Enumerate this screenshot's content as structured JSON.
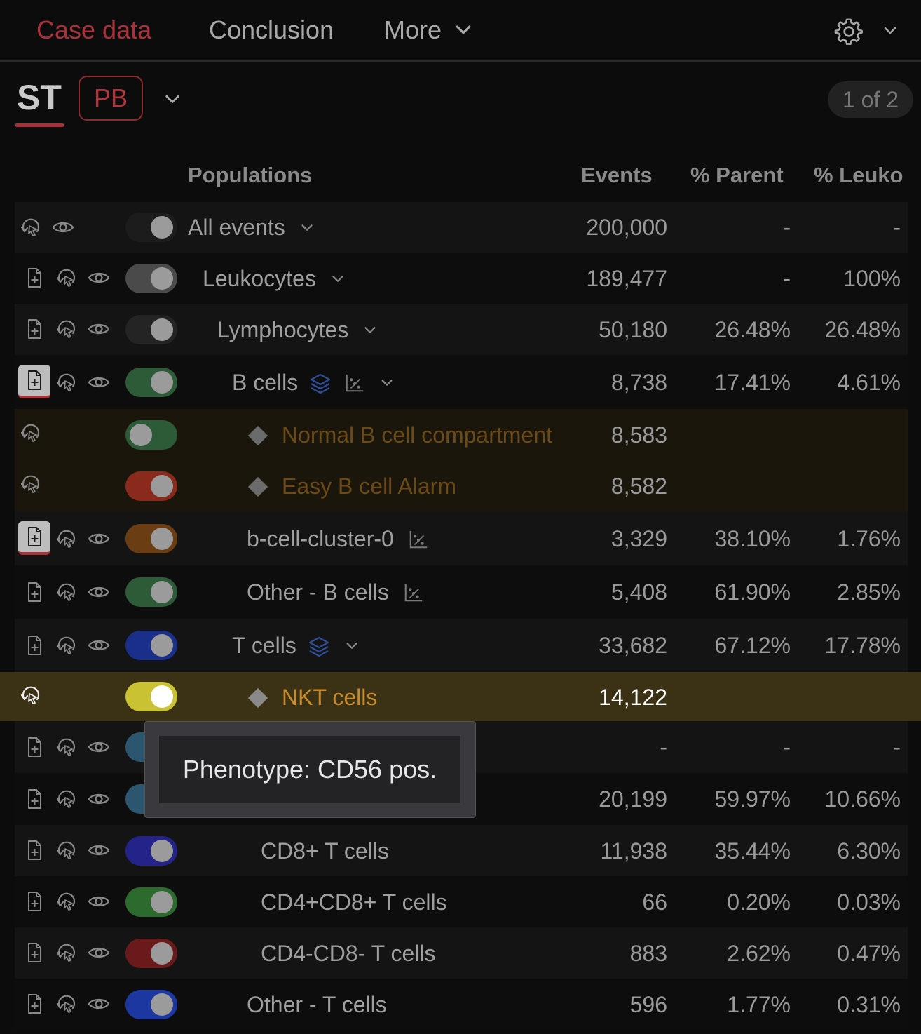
{
  "tabs": [
    {
      "label": "Case data",
      "active": true
    },
    {
      "label": "Conclusion",
      "active": false
    },
    {
      "label": "More",
      "active": false
    }
  ],
  "sample": {
    "code": "ST",
    "tube": "PB",
    "pager": "1 of 2"
  },
  "columns": {
    "populations": "Populations",
    "events": "Events",
    "parent": "% Parent",
    "leuko": "% Leuko"
  },
  "rows": [
    {
      "name": "All events",
      "events": "200,000",
      "parent": "-",
      "leuko": "-",
      "toggle_color": "#1c1c1c"
    },
    {
      "name": "Leukocytes",
      "events": "189,477",
      "parent": "-",
      "leuko": "100%",
      "toggle_color": "#4a4a4a"
    },
    {
      "name": "Lymphocytes",
      "events": "50,180",
      "parent": "26.48%",
      "leuko": "26.48%",
      "toggle_color": "#242424"
    },
    {
      "name": "B cells",
      "events": "8,738",
      "parent": "17.41%",
      "leuko": "4.61%",
      "toggle_color": "#2d5a37"
    },
    {
      "name": "Normal B cell compartment",
      "events": "8,583",
      "toggle_color": "#2d5a37"
    },
    {
      "name": "Easy B cell Alarm",
      "events": "8,582",
      "toggle_color": "#8a2a1c"
    },
    {
      "name": "b-cell-cluster-0",
      "events": "3,329",
      "parent": "38.10%",
      "leuko": "1.76%",
      "toggle_color": "#6a3d12"
    },
    {
      "name": "Other - B cells",
      "events": "5,408",
      "parent": "61.90%",
      "leuko": "2.85%",
      "toggle_color": "#2d5a37"
    },
    {
      "name": "T cells",
      "events": "33,682",
      "parent": "67.12%",
      "leuko": "17.78%",
      "toggle_color": "#1a2f8a"
    },
    {
      "name": "NKT cells",
      "events": "14,122",
      "toggle_color": "#c9c233"
    },
    {
      "events": "-",
      "parent": "-",
      "leuko": "-",
      "toggle_color": "#2c5670"
    },
    {
      "events": "20,199",
      "parent": "59.97%",
      "leuko": "10.66%",
      "toggle_color": "#2c5670"
    },
    {
      "name": "CD8+ T cells",
      "events": "11,938",
      "parent": "35.44%",
      "leuko": "6.30%",
      "toggle_color": "#23238a"
    },
    {
      "name": "CD4+CD8+ T cells",
      "events": "66",
      "parent": "0.20%",
      "leuko": "0.03%",
      "toggle_color": "#2d6a2d"
    },
    {
      "name": "CD4-CD8- T cells",
      "events": "883",
      "parent": "2.62%",
      "leuko": "0.47%",
      "toggle_color": "#6a1a1a"
    },
    {
      "name": "Other - T cells",
      "events": "596",
      "parent": "1.77%",
      "leuko": "0.31%",
      "toggle_color": "#1c38a0"
    }
  ],
  "tooltip": "Phenotype: CD56 pos.",
  "accent_color": "#a8313a"
}
